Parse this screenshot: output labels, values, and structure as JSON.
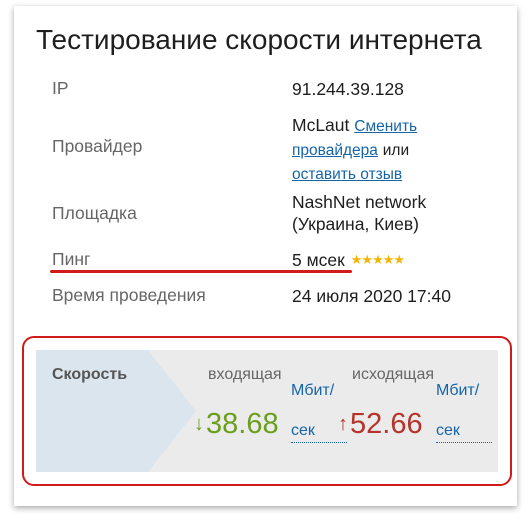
{
  "title": "Тестирование скорости интернета",
  "rows": {
    "ip": {
      "label": "IP",
      "value": "91.244.39.128"
    },
    "provider": {
      "label": "Провайдер",
      "value": "McLaut",
      "change_link_1": "Сменить",
      "change_link_2": "провайдера",
      "or_text": "или",
      "review_link": "оставить отзыв"
    },
    "site": {
      "label": "Площадка",
      "line1": "NashNet network",
      "line2": "(Украина, Киев)"
    },
    "ping": {
      "label": "Пинг",
      "value": "5 мсек",
      "stars": "★★★★★"
    },
    "time": {
      "label": "Время проведения",
      "value": "24 июля 2020 17:40"
    }
  },
  "speed": {
    "label": "Скорость",
    "download": {
      "label": "входящая",
      "arrow": "↓",
      "value": "38.68",
      "unit_line1": "Мбит/",
      "unit_line2": "сек",
      "color": "#6b9e1f"
    },
    "upload": {
      "label": "исходящая",
      "arrow": "↑",
      "value": "52.66",
      "unit_line1": "Мбит/",
      "unit_line2": "сек",
      "color": "#b5332a"
    }
  },
  "colors": {
    "accent_red": "#d11a1a",
    "link": "#1565a8",
    "star": "#f4b400"
  }
}
